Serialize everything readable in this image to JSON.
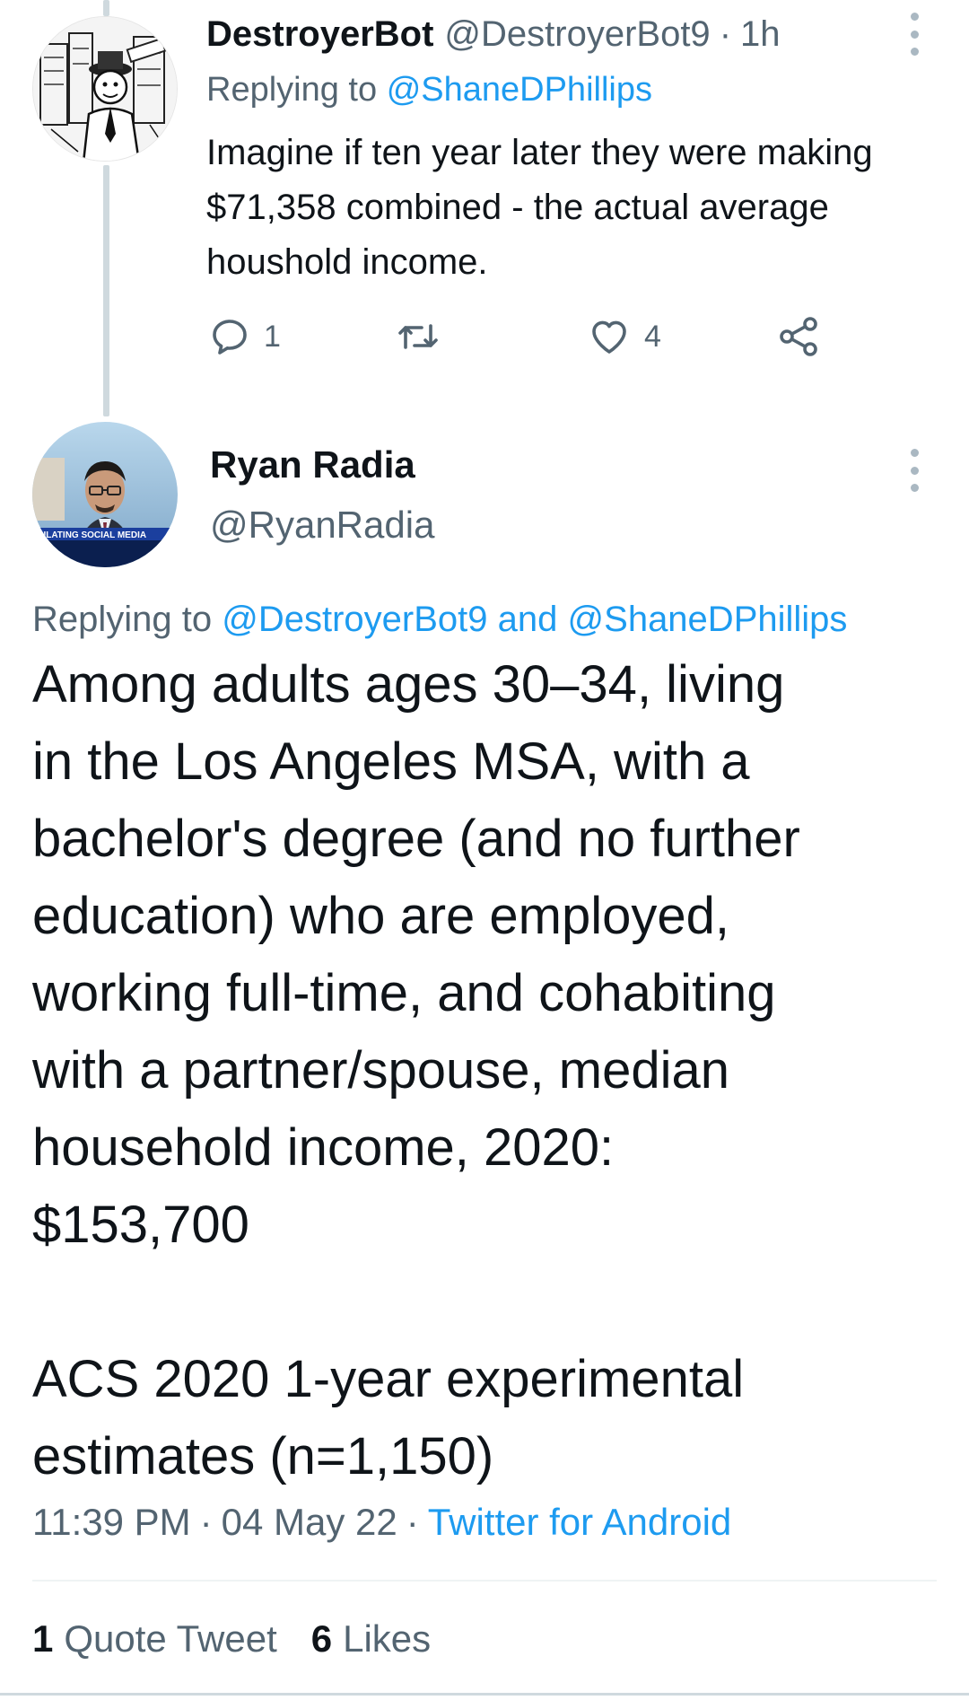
{
  "reply_tweet": {
    "display_name": "DestroyerBot",
    "handle": "@DestroyerBot9",
    "separator": "·",
    "time_ago": "1h",
    "replying_prefix": "Replying to",
    "replying_to": "@ShaneDPhillips",
    "text": "Imagine if ten year later they were making $71,358 combined - the actual average houshold income.",
    "reply_count": "1",
    "retweet_count": "",
    "like_count": "4",
    "icons": {
      "avatar": "comic-avatar-icon",
      "more": "more-vertical-icon",
      "reply": "reply-bubble-icon",
      "retweet": "retweet-icon",
      "like": "heart-icon",
      "share": "share-icon"
    }
  },
  "main_tweet": {
    "display_name": "Ryan Radia",
    "handle": "@RyanRadia",
    "avatar_caption": "ULATING SOCIAL MEDIA",
    "replying_prefix": "Replying to",
    "replying_to_1": "@DestroyerBot9",
    "replying_conjunction": "and",
    "replying_to_2": "@ShaneDPhillips",
    "text_paragraph_1": "Among adults ages 30–34, living\nin the Los Angeles MSA, with a\nbachelor's degree (and no further\neducation) who are employed,\nworking full-time, and cohabiting\nwith a partner/spouse, median\nhousehold income, 2020:\n$153,700",
    "text_paragraph_2": "ACS 2020 1-year experimental\nestimates (n=1,150)",
    "time": "11:39 PM",
    "date": "04 May 22",
    "source": "Twitter for Android",
    "separator": "·",
    "quote_tweets_count": "1",
    "quote_tweets_label": "Quote Tweet",
    "likes_count": "6",
    "likes_label": "Likes"
  },
  "colors": {
    "link": "#1d9bf0",
    "muted": "#536471",
    "text": "#0f1419",
    "divider": "#eff3f4",
    "thread_line": "#cfd9de"
  }
}
